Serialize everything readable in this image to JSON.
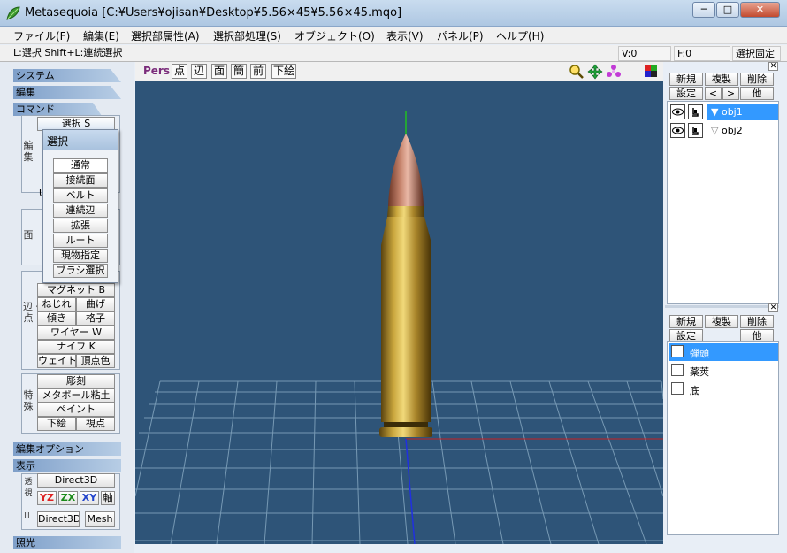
{
  "window": {
    "title": "Metasequoia [C:¥Users¥ojisan¥Desktop¥5.56×45¥5.56×45.mqo]",
    "minimize": "─",
    "maximize": "□",
    "close": "✕"
  },
  "menu": [
    "ファイル(F)",
    "編集(E)",
    "選択部属性(A)",
    "選択部処理(S)",
    "オブジェクト(O)",
    "表示(V)",
    "パネル(P)",
    "ヘルプ(H)"
  ],
  "status": {
    "hint": "L:選択  Shift+L:連続選択",
    "vertices": "V:0",
    "faces": "F:0",
    "fixed": "選択固定"
  },
  "left": {
    "system": "システム",
    "edit": "編集",
    "command": "コマンド",
    "select_button": "選択 S",
    "group_edit": "編集",
    "group_face": "面",
    "group_edge": "辺・点",
    "group_special": "特殊",
    "hidden_u": "U",
    "hidden_k": "一",
    "magnet": "マグネット B",
    "twist": "ねじれ",
    "bend": "曲げ",
    "tilt": "傾き",
    "lattice": "格子",
    "wire": "ワイヤー W",
    "knife": "ナイフ K",
    "weight": "ウェイト",
    "vertex_color": "頂点色",
    "sculpt": "彫刻",
    "metaball": "メタボール粘土",
    "paint": "ペイント",
    "underlay": "下絵",
    "viewpoint": "視点",
    "edit_options": "編集オプション",
    "display": "表示",
    "perspective_label": "透視",
    "direct3d": "Direct3D",
    "axis_yz": "YZ",
    "axis_zx": "ZX",
    "axis_xy": "XY",
    "axis": "軸",
    "direct3d_small": "Direct3D",
    "mesh": "Mesh",
    "lighting": "照光",
    "pane_icon": "Ⅲ"
  },
  "popup": {
    "title": "選択",
    "items": [
      "通常",
      "接続面",
      "ベルト",
      "連続辺",
      "拡張",
      "ルート",
      "現物指定",
      "ブラシ選択"
    ]
  },
  "viewport": {
    "mode": "Pers",
    "buttons": [
      "点",
      "辺",
      "面",
      "簡",
      "前",
      "下絵"
    ],
    "tool_icons": [
      "zoom-icon",
      "move-icon",
      "rotate-icon",
      "color-icon"
    ]
  },
  "objects": {
    "new": "新規",
    "copy": "複製",
    "delete": "削除",
    "settings": "設定",
    "prev": "<",
    "next": ">",
    "other": "他",
    "items": [
      {
        "name": "obj1",
        "selected": true
      },
      {
        "name": "obj2",
        "selected": false
      }
    ]
  },
  "materials": {
    "new": "新規",
    "copy": "複製",
    "delete": "削除",
    "settings": "設定",
    "other": "他",
    "items": [
      {
        "name": "弾頭",
        "selected": true
      },
      {
        "name": "薬莢",
        "selected": false
      },
      {
        "name": "底",
        "selected": false
      }
    ]
  },
  "colors": {
    "viewport_bg": "#2e5478",
    "selection": "#3399ff",
    "grid": "#8fb0c8",
    "bullet_tip": "#c8866f",
    "case_brass": "#c8a53c"
  }
}
